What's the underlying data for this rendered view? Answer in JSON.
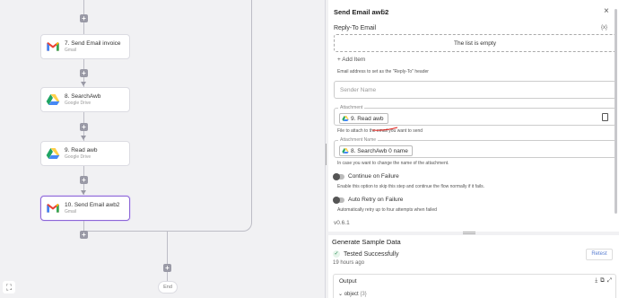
{
  "canvas": {
    "nodes": [
      {
        "title": "7. Send Email invoice",
        "subtitle": "Gmail",
        "icon": "gmail-icon"
      },
      {
        "title": "8. SearchAwb",
        "subtitle": "Google Drive",
        "icon": "google-drive-icon"
      },
      {
        "title": "9. Read awb",
        "subtitle": "Google Drive",
        "icon": "google-drive-icon"
      },
      {
        "title": "10. Send Email awb2",
        "subtitle": "Gmail",
        "icon": "gmail-icon"
      }
    ],
    "end_label": "End",
    "plus_symbol": "+",
    "fit_symbol": "⛶"
  },
  "panel": {
    "title": "Send Email awb2",
    "close_symbol": "×",
    "reply_to_label": "Reply-To Email",
    "fx_label": "{x}",
    "list_empty": "The list is empty",
    "add_item": "+ Add Item",
    "reply_to_help": "Email address to set as the \"Reply-To\" header",
    "sender_name_placeholder": "Sender Name",
    "attachment_legend": "Attachment",
    "attachment_chip": "9. Read awb",
    "attachment_help": "File to attach to the email you want to send",
    "attachment_name_legend": "Attachment Name",
    "attachment_name_chip": "8. SearchAwb 0 name",
    "attachment_name_help": "In case you want to change the name of the attachment.",
    "continue_on_failure": "Continue on Failure",
    "continue_help": "Enable this option to skip this step and continue the flow normally if it fails.",
    "auto_retry": "Auto Retry on Failure",
    "auto_retry_help": "Automatically retry up to four attempts when failed",
    "version": "v0.6.1"
  },
  "sample": {
    "title": "Generate Sample Data",
    "status": "Tested Successfully",
    "check_symbol": "✓",
    "ago": "19 hours ago",
    "retest": "Retest",
    "output_label": "Output",
    "object_label": "object",
    "object_count": "{3}",
    "icons": [
      "download-icon",
      "copy-icon",
      "expand-icon"
    ]
  },
  "colors": {
    "selected_border": "#8c67d6",
    "gmail_red": "#ea4335",
    "drive_green": "#1fa463",
    "drive_yellow": "#ffd04b",
    "drive_blue": "#4688f4",
    "annotation_red": "#e0201a"
  }
}
